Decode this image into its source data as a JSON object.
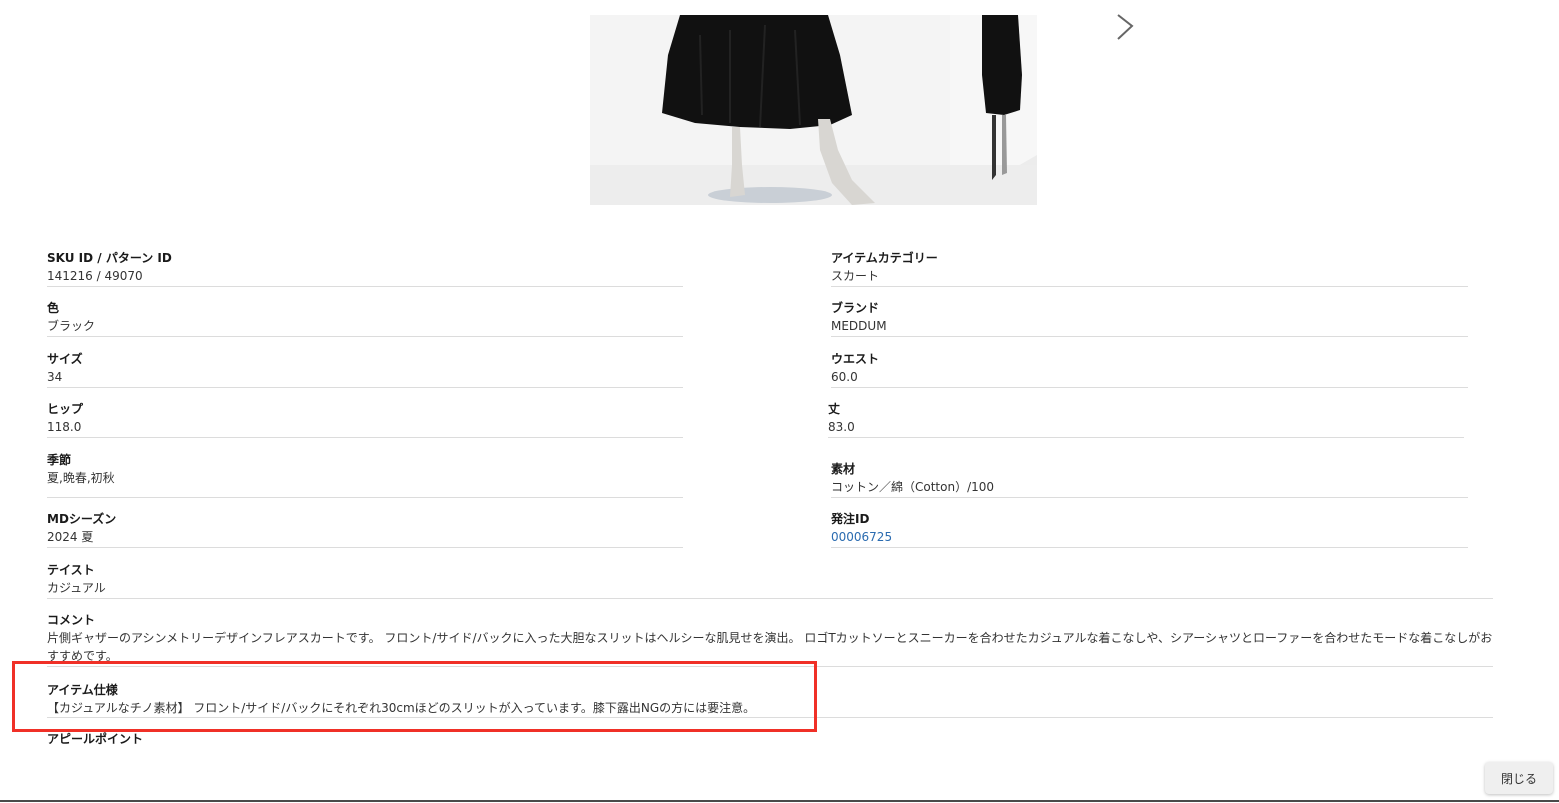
{
  "fields": {
    "sku_label": "SKU ID / パターン ID",
    "sku_value": "141216 / 49070",
    "category_label": "アイテムカテゴリー",
    "category_value": "スカート",
    "color_label": "色",
    "color_value": "ブラック",
    "brand_label": "ブランド",
    "brand_value": "MEDDUM",
    "size_label": "サイズ",
    "size_value": "34",
    "waist_label": "ウエスト",
    "waist_value": "60.0",
    "hip_label": "ヒップ",
    "hip_value": "118.0",
    "length_label": "丈",
    "length_value": "83.0",
    "season_label": "季節",
    "season_value": "夏,晩春,初秋",
    "material_label": "素材",
    "material_value": "コットン／綿（Cotton）/100",
    "md_season_label": "MDシーズン",
    "md_season_value": "2024 夏",
    "order_id_label": "発注ID",
    "order_id_value": "00006725",
    "taste_label": "テイスト",
    "taste_value": "カジュアル",
    "comment_label": "コメント",
    "comment_value": "片側ギャザーのアシンメトリーデザインフレアスカートです。 フロント/サイド/バックに入った大胆なスリットはヘルシーな肌見せを演出。 ロゴTカットソーとスニーカーを合わせたカジュアルな着こなしや、シアーシャツとローファーを合わせたモードな着こなしがおすすめです。",
    "spec_label": "アイテム仕様",
    "spec_value": "【カジュアルなチノ素材】 フロント/サイド/バックにそれぞれ30cmほどのスリットが入っています。膝下露出NGの方には要注意。",
    "appeal_label": "アピールポイント"
  },
  "buttons": {
    "close_label": "閉じる"
  },
  "icons": {
    "next": "chevron-right-icon"
  },
  "colors": {
    "highlight": "#f03027",
    "link": "#2a6bb0"
  }
}
